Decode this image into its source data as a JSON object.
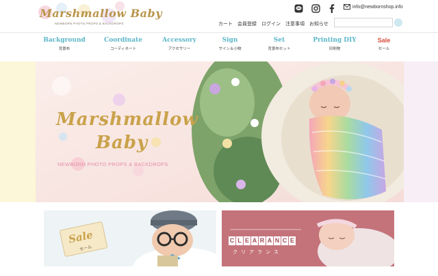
{
  "header": {
    "logo": {
      "title": "Marshmallow Baby",
      "subtitle": "NEWBORN PHOTO PROPS & BACKDROPS"
    },
    "social": [
      {
        "name": "line-icon"
      },
      {
        "name": "instagram-icon"
      },
      {
        "name": "facebook-icon"
      }
    ],
    "email": "info@newbornshop.info",
    "util_nav": [
      "カート",
      "会員登録",
      "ログイン",
      "注意事項",
      "お知らせ"
    ],
    "search": {
      "placeholder": "",
      "value": ""
    }
  },
  "categories": [
    {
      "en": "Background",
      "jp": "背景布"
    },
    {
      "en": "Coordinate",
      "jp": "コーディネート"
    },
    {
      "en": "Accessory",
      "jp": "アクセサリー"
    },
    {
      "en": "Sign",
      "jp": "サイン＆小物"
    },
    {
      "en": "Set",
      "jp": "背景布セット"
    },
    {
      "en": "Printing DIY",
      "jp": "印刷物"
    },
    {
      "en": "Sale",
      "jp": "セール"
    }
  ],
  "hero": {
    "title_line1": "Marshmallow",
    "title_line2": "Baby",
    "subtitle": "NEWBORN PHOTO PROPS & BACKDROPS"
  },
  "banners": {
    "sale": {
      "label": "Sale",
      "sub": "セール"
    },
    "clearance": {
      "letters": [
        "C",
        "L",
        "E",
        "A",
        "R",
        "A",
        "N",
        "C",
        "E"
      ],
      "sub": "クリアランス"
    }
  },
  "colors": {
    "accent_teal": "#5bb6c8",
    "sale_red": "#d84b3a",
    "gold": "#c9a24a",
    "clearance_bg": "#c4737a"
  }
}
